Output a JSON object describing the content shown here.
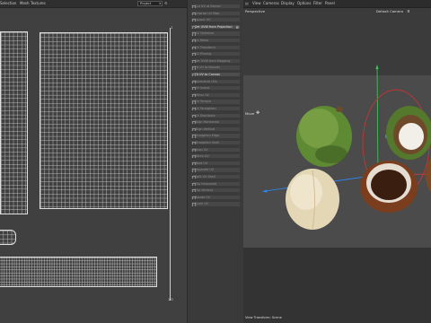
{
  "uv_menu": [
    "Selection",
    "Mesh",
    "Textures"
  ],
  "project_select": {
    "value": "Project"
  },
  "ruler": {
    "top": "1",
    "bottom": "1.0"
  },
  "cmd_panel": {
    "items": [
      {
        "label": "Cut UV at Seams",
        "active": false
      },
      {
        "label": "Unwrap UV Map",
        "active": false
      },
      {
        "label": "Layout UV",
        "active": false
      },
      {
        "label": "Set UVW from Projection",
        "active": true
      },
      {
        "label": "UV Optimize",
        "active": false
      },
      {
        "label": "UV Relax",
        "active": false
      },
      {
        "label": "UV Transform",
        "active": false
      },
      {
        "label": "UV Pinning",
        "active": false
      },
      {
        "label": "Set UVW from Mapping",
        "active": false
      },
      {
        "label": "Fit UV to Bounds",
        "active": false
      },
      {
        "label": "Fit UV to Canvas",
        "active": true
      },
      {
        "label": "Normalize UVs",
        "active": false
      },
      {
        "label": "UV Island",
        "active": false
      },
      {
        "label": "Mirror UV",
        "active": false
      },
      {
        "label": "UV Terrace",
        "active": false
      },
      {
        "label": "UV Straighten",
        "active": false
      },
      {
        "label": "UV Distribute",
        "active": false
      },
      {
        "label": "Align Horizontal",
        "active": false
      },
      {
        "label": "Align Vertical",
        "active": false
      },
      {
        "label": "Straighten Edge",
        "active": false
      },
      {
        "label": "Straighten Shell",
        "active": false
      },
      {
        "label": "Snap UV",
        "active": false
      },
      {
        "label": "Stitch UV",
        "active": false
      },
      {
        "label": "Weld UV",
        "active": false
      },
      {
        "label": "Separate UV",
        "active": false
      },
      {
        "label": "Split UV Shell",
        "active": false
      },
      {
        "label": "Flip Horizontal",
        "active": false
      },
      {
        "label": "Flip Vertical",
        "active": false
      },
      {
        "label": "Rotate UV",
        "active": false
      },
      {
        "label": "Scale UV",
        "active": false
      }
    ]
  },
  "viewport": {
    "menu": [
      "View",
      "Cameras",
      "Display",
      "Options",
      "Filter",
      "Panel"
    ],
    "label_perspective": "Perspective",
    "label_camera": "Default Camera",
    "move_label": "Move",
    "status": "View Transform: Scene"
  },
  "colors": {
    "accent": "#ffffff",
    "axis_green": "#3ecf5a",
    "axis_blue": "#2b8cff",
    "axis_red": "#e23c3c"
  }
}
